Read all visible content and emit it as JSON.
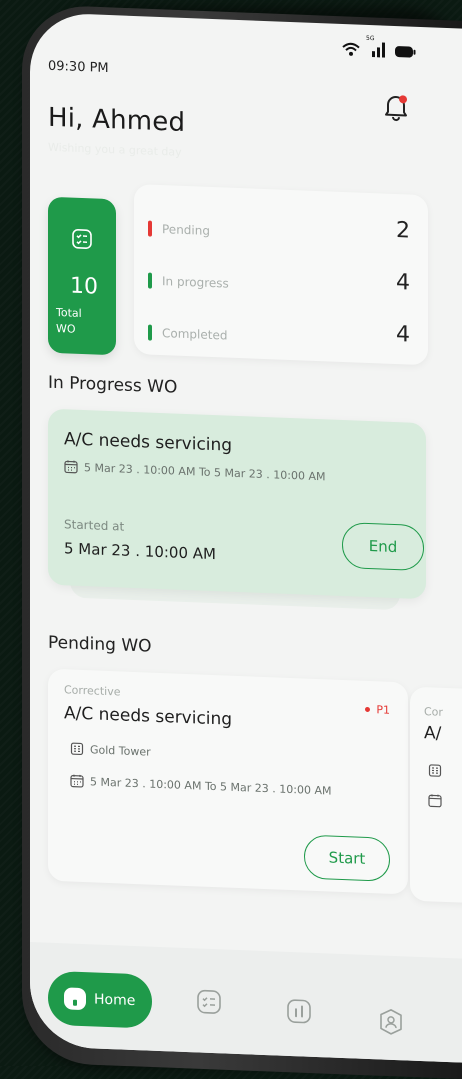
{
  "status_bar": {
    "time": "09:30 PM",
    "network": "5G"
  },
  "header": {
    "greeting": "Hi, Ahmed",
    "subtitle": "Wishing you a great day"
  },
  "summary": {
    "total_value": "10",
    "total_label_line1": "Total",
    "total_label_line2": "WO",
    "stats": [
      {
        "label": "Pending",
        "value": "2",
        "color": "#e53935"
      },
      {
        "label": "In progress",
        "value": "4",
        "color": "#1f9a4a"
      },
      {
        "label": "Completed",
        "value": "4",
        "color": "#1f9a4a"
      }
    ]
  },
  "in_progress": {
    "section_title": "In Progress WO",
    "card": {
      "title": "A/C needs servicing",
      "dates": "5 Mar 23 . 10:00 AM  To 5 Mar 23 . 10:00 AM",
      "started_label": "Started at",
      "started_value": "5 Mar 23 . 10:00 AM",
      "end_label": "End"
    }
  },
  "pending": {
    "section_title": "Pending WO",
    "cards": [
      {
        "type": "Corrective",
        "priority": "P1",
        "title": "A/C needs servicing",
        "location": "Gold Tower",
        "dates": "5 Mar 23 . 10:00 AM  To 5 Mar 23 . 10:00 AM",
        "start_label": "Start"
      },
      {
        "type": "Cor",
        "title": "A/"
      }
    ]
  },
  "nav": {
    "home_label": "Home"
  },
  "colors": {
    "brand": "#1f9a4a",
    "alert": "#e53935"
  }
}
